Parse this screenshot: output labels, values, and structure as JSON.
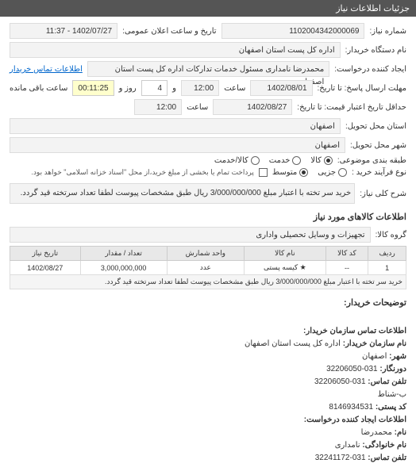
{
  "header": {
    "title": "جزئیات اطلاعات نیاز"
  },
  "form": {
    "need_no_label": "شماره نیاز:",
    "need_no": "1102004342000069",
    "announce_label": "تاریخ و ساعت اعلان عمومی:",
    "announce_value": "1402/07/27 - 11:37",
    "buyer_org_label": "نام دستگاه خریدار:",
    "buyer_org": "اداره کل پست استان اصفهان",
    "requester_label": "ایجاد کننده درخواست:",
    "requester": "محمدرضا نامداری مسئول خدمات تدارکات اداره کل پست استان اصفهان",
    "buyer_contact_link": "اطلاعات تماس خریدار",
    "deadline_label": "مهلت ارسال پاسخ: تا تاریخ:",
    "deadline_date": "1402/08/01",
    "time_label": "ساعت",
    "deadline_time": "12:00",
    "remain_label_and": "و",
    "remain_days": "4",
    "remain_label_day": "روز و",
    "remain_time": "00:11:25",
    "remain_label_end": "ساعت باقی مانده",
    "valid_label": "حداقل تاریخ اعتبار قیمت: تا تاریخ:",
    "valid_date": "1402/08/27",
    "valid_time": "12:00",
    "province_label": "استان محل تحویل:",
    "province": "اصفهان",
    "city_label": "شهر محل تحویل:",
    "city": "اصفهان",
    "cat_label": "طبقه بندی موضوعی:",
    "cat_kala": "کالا",
    "cat_service": "خدمت",
    "cat_both": "کالا/خدمت",
    "buy_type_label": "نوع فرآیند خرید :",
    "buy_partial": "جزیی",
    "buy_medium": "متوسط",
    "buy_note": "پرداخت تمام یا بخشی از مبلغ خرید،از محل \"اسناد خزانه اسلامی\" خواهد بود.",
    "desc_label": "شرح کلی نیاز:",
    "desc": "خرید سر تخته با اعتبار مبلغ 3/000/000/000 ریال طبق مشخصات پیوست لطفا تعداد سرتخته قید گردد.",
    "items_title": "اطلاعات کالاهای مورد نیاز",
    "group_label": "گروه کالا:",
    "group": "تجهیزات و وسایل تحصیلی واداری",
    "notes_title": "توضیحات خریدار:"
  },
  "table": {
    "headers": {
      "row": "ردیف",
      "code": "کد کالا",
      "name": "نام کالا",
      "unit": "واحد شمارش",
      "qty": "تعداد / مقدار",
      "date": "تاریخ نیاز"
    },
    "rows": [
      {
        "row": "1",
        "code": "--",
        "name_icon": "★",
        "name": "کیسه پستی",
        "unit": "عدد",
        "qty": "3,000,000,000",
        "date": "1402/08/27",
        "desc": "خرید سر تخته با اعتبار مبلغ 3/000/000/000 ریال طبق مشخصات پیوست لطفا تعداد سرتخته قید گردد."
      }
    ]
  },
  "contact": {
    "title": "اطلاعات تماس سازمان خریدار:",
    "org_label": "نام سازمان خریدار:",
    "org": "اداره کل پست استان اصفهان",
    "city_label": "شهر:",
    "city": "اصفهان",
    "fax_label": "دورنگار:",
    "fax": "031-32206050",
    "phone_label": "تلفن تماس:",
    "phone": "031-32206050",
    "sub_label": "ب-شناط",
    "postal_label": "کد پستی:",
    "postal": "8146934531",
    "req_title": "اطلاعات ایجاد کننده درخواست:",
    "fname_label": "نام:",
    "fname": "محمدرضا",
    "lname_label": "نام خانوادگی:",
    "lname": "نامداری",
    "req_phone_label": "تلفن تماس:",
    "req_phone": "031-32241172"
  }
}
